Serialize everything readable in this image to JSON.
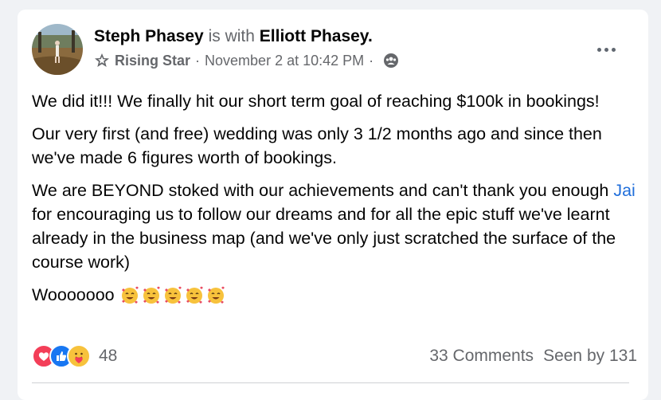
{
  "post": {
    "author": "Steph Phasey",
    "with_text": "is with",
    "tagged": "Elliott Phasey",
    "period": ".",
    "badge": "Rising Star",
    "separator": "·",
    "timestamp": "November 2 at 10:42 PM",
    "privacy_icon": "group-icon",
    "body": {
      "p1": "We did it!!! We finally hit our short term goal of reaching $100k in bookings!",
      "p2": "Our very first (and free) wedding was only 3 1/2 months ago and since then we've made 6 figures worth of bookings.",
      "p3_before": "We are BEYOND stoked with our achievements and can't thank you enough ",
      "p3_link": "Jai",
      "p3_after": " for encouraging us to follow our dreams and for all the epic stuff we've learnt already in the business map (and we've only just scratched the surface of the course work)",
      "p4": "Wooooooo"
    },
    "emoji_count_icon": "smiling-face-with-hearts-icon"
  },
  "footer": {
    "reaction_icons": [
      "love-icon",
      "like-icon",
      "care-icon"
    ],
    "reaction_count": "48",
    "comments": "33 Comments",
    "seen": "Seen by 131"
  },
  "colors": {
    "link": "#216fdb",
    "muted": "#65676b",
    "like": "#1877f2",
    "love": "#f33e58"
  }
}
